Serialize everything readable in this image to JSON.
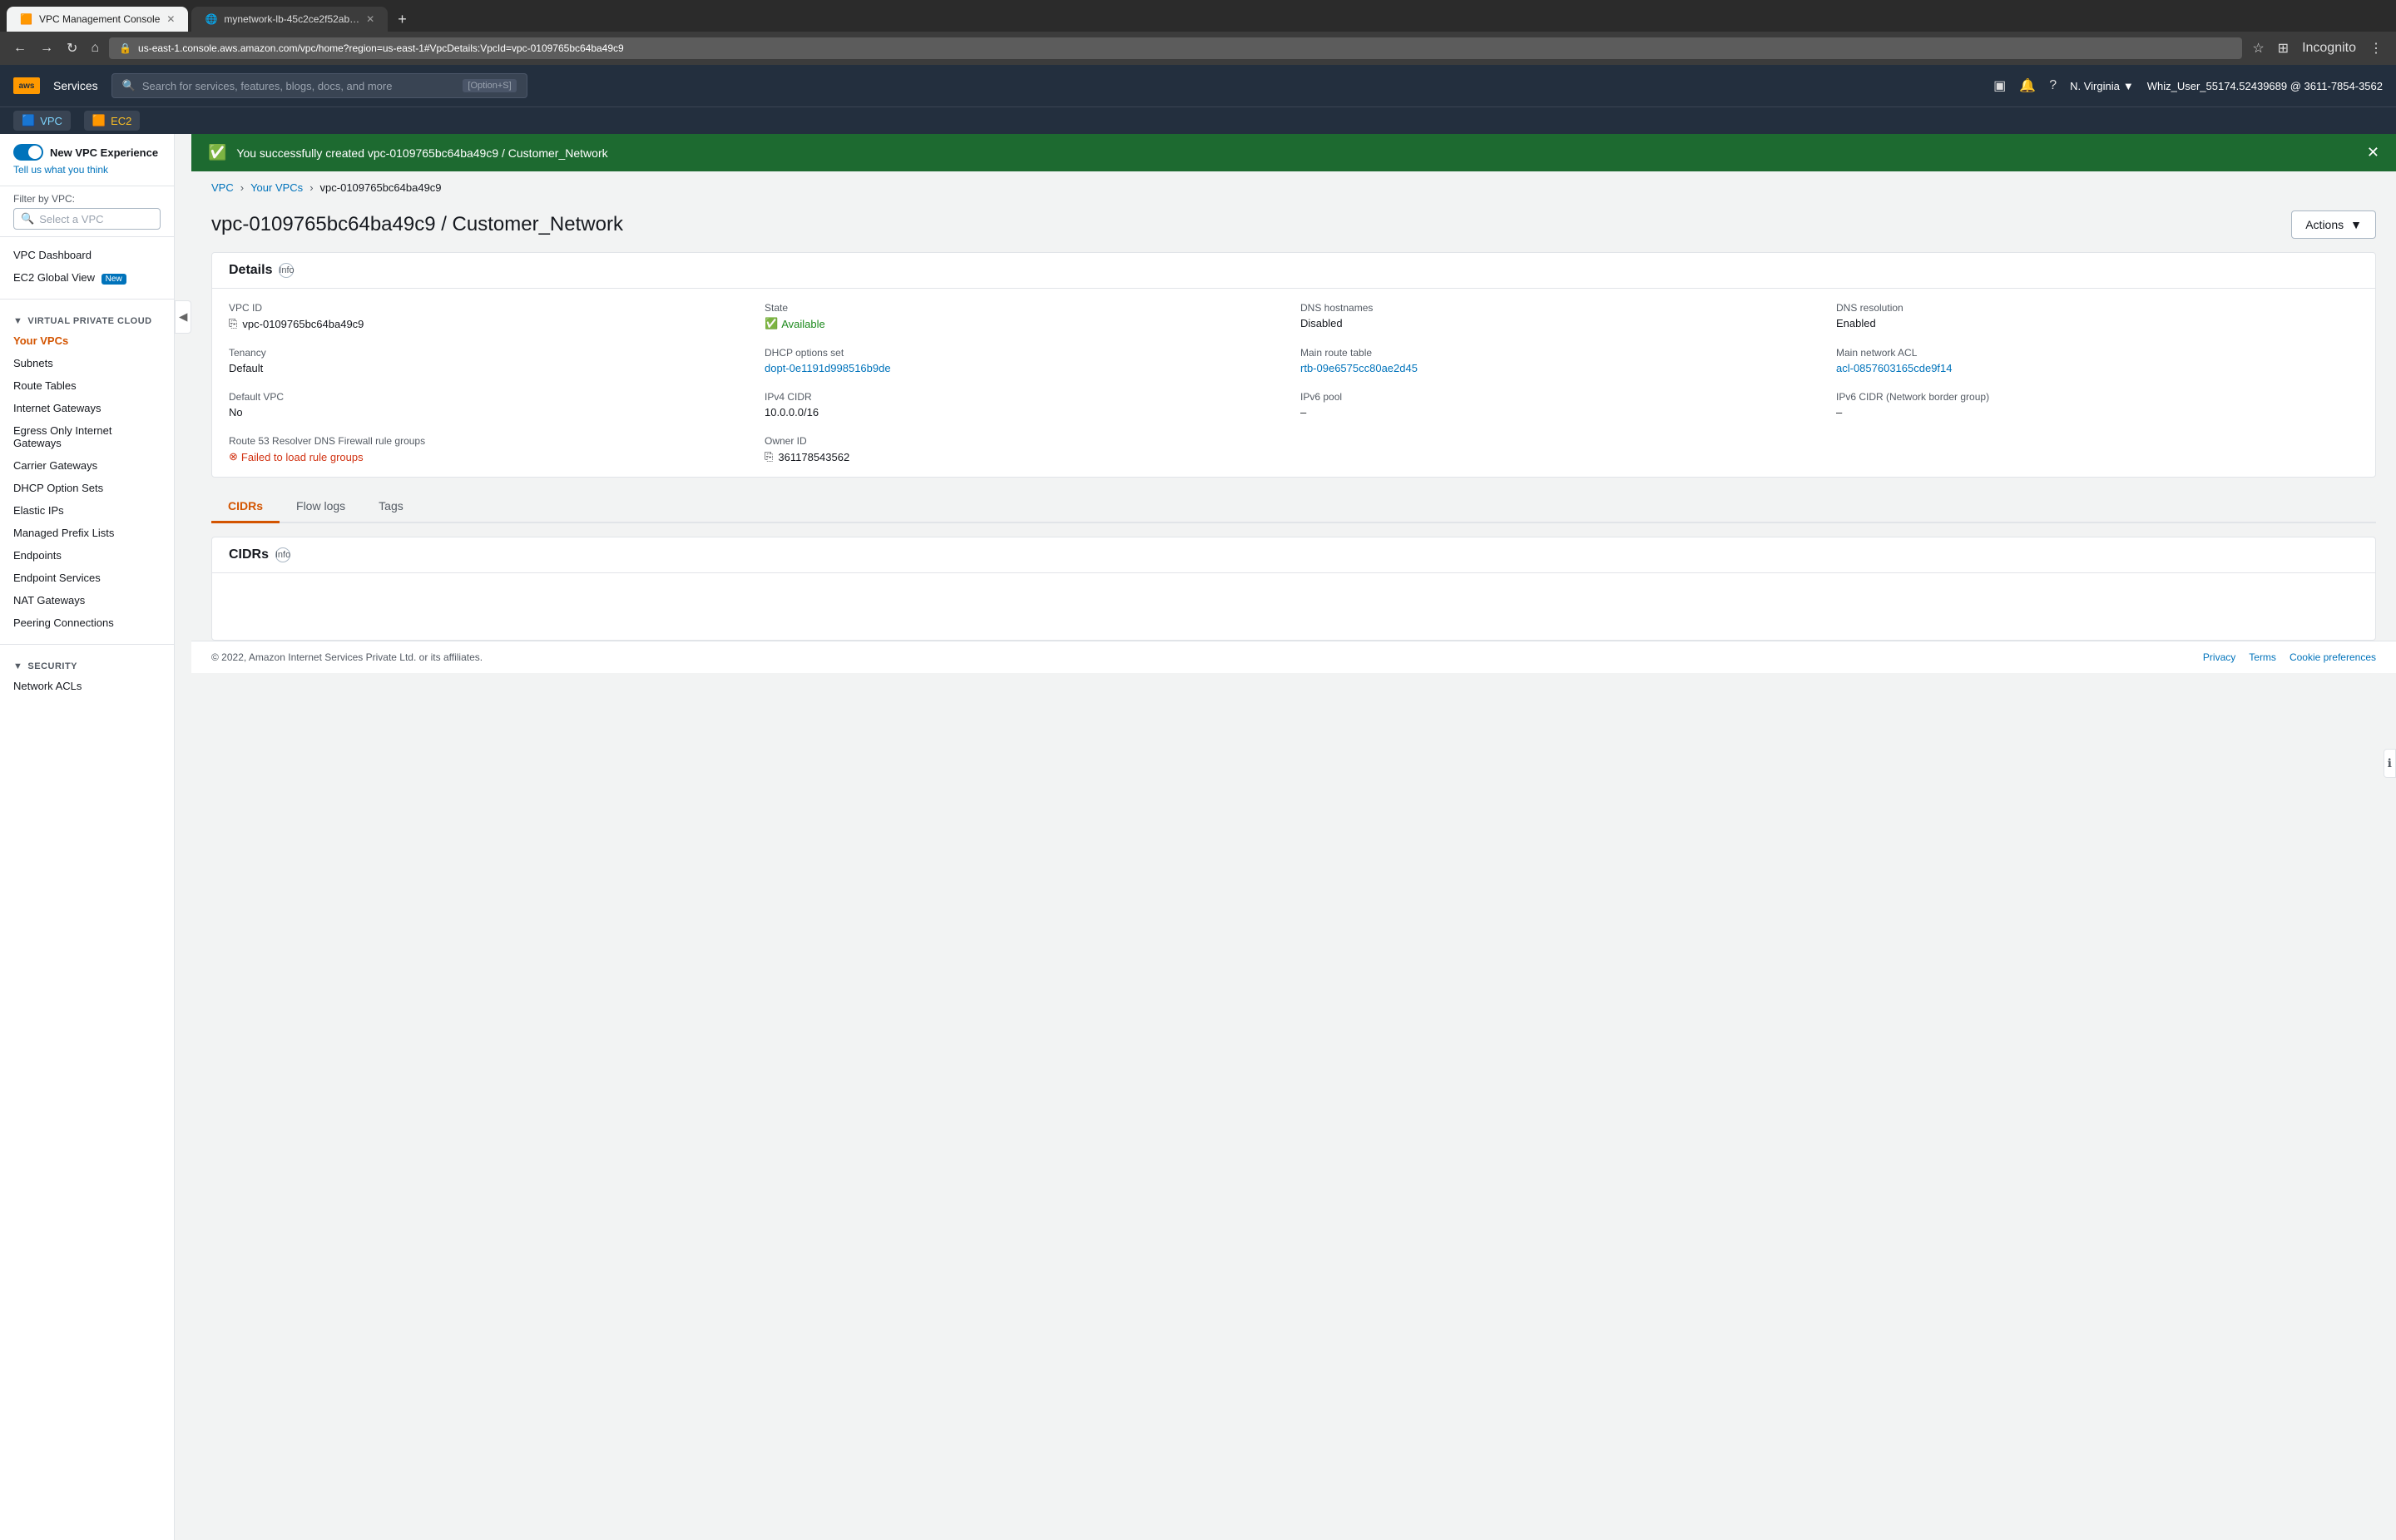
{
  "browser": {
    "tabs": [
      {
        "id": "vpc-tab",
        "favicon": "🟧",
        "label": "VPC Management Console",
        "active": true
      },
      {
        "id": "network-tab",
        "favicon": "🌐",
        "label": "mynetwork-lb-45c2ce2f52ab…",
        "active": false
      }
    ],
    "new_tab_label": "+",
    "url": "us-east-1.console.aws.amazon.com/vpc/home?region=us-east-1#VpcDetails:VpcId=vpc-0109765bc64ba49c9",
    "lock_icon": "🔒",
    "nav_back": "←",
    "nav_forward": "→",
    "nav_reload": "↻",
    "nav_home": "⌂",
    "star_icon": "☆",
    "grid_icon": "⊞",
    "incognito": "Incognito",
    "more_icon": "⋮"
  },
  "aws_header": {
    "logo_text": "aws",
    "services_label": "Services",
    "search_placeholder": "Search for services, features, blogs, docs, and more",
    "search_shortcut": "[Option+S]",
    "terminal_icon": "▣",
    "bell_icon": "🔔",
    "help_icon": "?",
    "region": "N. Virginia",
    "region_arrow": "▼",
    "user": "Whiz_User_55174.52439689 @ 3611-7854-3562"
  },
  "service_bar": {
    "vpc_icon": "🟦",
    "vpc_label": "VPC",
    "ec2_icon": "🟧",
    "ec2_label": "EC2"
  },
  "sidebar": {
    "new_vpc_experience_label": "New VPC Experience",
    "tell_us_link": "Tell us what you think",
    "filter_label": "Filter by VPC:",
    "filter_placeholder": "Select a VPC",
    "items": [
      {
        "id": "vpc-dashboard",
        "label": "VPC Dashboard",
        "active": false
      },
      {
        "id": "ec2-global-view",
        "label": "EC2 Global View",
        "active": false,
        "badge": "New"
      },
      {
        "id": "section-vpc",
        "type": "section",
        "label": "VIRTUAL PRIVATE CLOUD"
      },
      {
        "id": "your-vpcs",
        "label": "Your VPCs",
        "active": true
      },
      {
        "id": "subnets",
        "label": "Subnets",
        "active": false
      },
      {
        "id": "route-tables",
        "label": "Route Tables",
        "active": false
      },
      {
        "id": "internet-gateways",
        "label": "Internet Gateways",
        "active": false
      },
      {
        "id": "egress-only",
        "label": "Egress Only Internet Gateways",
        "active": false
      },
      {
        "id": "carrier-gateways",
        "label": "Carrier Gateways",
        "active": false
      },
      {
        "id": "dhcp-option-sets",
        "label": "DHCP Option Sets",
        "active": false
      },
      {
        "id": "elastic-ips",
        "label": "Elastic IPs",
        "active": false
      },
      {
        "id": "managed-prefix-lists",
        "label": "Managed Prefix Lists",
        "active": false
      },
      {
        "id": "endpoints",
        "label": "Endpoints",
        "active": false
      },
      {
        "id": "endpoint-services",
        "label": "Endpoint Services",
        "active": false
      },
      {
        "id": "nat-gateways",
        "label": "NAT Gateways",
        "active": false
      },
      {
        "id": "peering-connections",
        "label": "Peering Connections",
        "active": false
      },
      {
        "id": "section-security",
        "type": "section",
        "label": "SECURITY"
      },
      {
        "id": "network-acls",
        "label": "Network ACLs",
        "active": false
      }
    ],
    "collapse_icon": "◀"
  },
  "success_banner": {
    "icon": "✅",
    "message": "You successfully created vpc-0109765bc64ba49c9 / Customer_Network",
    "close_icon": "✕"
  },
  "breadcrumb": {
    "items": [
      {
        "label": "VPC",
        "link": true
      },
      {
        "label": "Your VPCs",
        "link": true
      },
      {
        "label": "vpc-0109765bc64ba49c9",
        "link": false
      }
    ],
    "separator": "›"
  },
  "page_header": {
    "title": "vpc-0109765bc64ba49c9 / Customer_Network",
    "actions_label": "Actions",
    "actions_arrow": "▼"
  },
  "details_card": {
    "title": "Details",
    "info_label": "Info",
    "fields": [
      {
        "row": 1,
        "items": [
          {
            "label": "VPC ID",
            "value": "vpc-0109765bc64ba49c9",
            "type": "copy",
            "copy_icon": "⎘"
          },
          {
            "label": "State",
            "value": "Available",
            "type": "status-available",
            "icon": "✅"
          },
          {
            "label": "DNS hostnames",
            "value": "Disabled",
            "type": "text"
          },
          {
            "label": "DNS resolution",
            "value": "Enabled",
            "type": "text"
          }
        ]
      },
      {
        "row": 2,
        "items": [
          {
            "label": "Tenancy",
            "value": "Default",
            "type": "text"
          },
          {
            "label": "DHCP options set",
            "value": "dopt-0e1191d998516b9de",
            "type": "link"
          },
          {
            "label": "Main route table",
            "value": "rtb-09e6575cc80ae2d45",
            "type": "link"
          },
          {
            "label": "Main network ACL",
            "value": "acl-0857603165cde9f14",
            "type": "link"
          }
        ]
      },
      {
        "row": 3,
        "items": [
          {
            "label": "Default VPC",
            "value": "No",
            "type": "text"
          },
          {
            "label": "IPv4 CIDR",
            "value": "10.0.0.0/16",
            "type": "text"
          },
          {
            "label": "IPv6 pool",
            "value": "–",
            "type": "text"
          },
          {
            "label": "IPv6 CIDR (Network border group)",
            "value": "–",
            "type": "text"
          }
        ]
      },
      {
        "row": 4,
        "items": [
          {
            "label": "Route 53 Resolver DNS Firewall rule groups",
            "value": "Failed to load rule groups",
            "type": "error",
            "error_icon": "⊗"
          },
          {
            "label": "Owner ID",
            "value": "361178543562",
            "type": "copy-owner",
            "copy_icon": "⎘"
          },
          {
            "label": "",
            "value": "",
            "type": "empty"
          },
          {
            "label": "",
            "value": "",
            "type": "empty"
          }
        ]
      }
    ]
  },
  "tabs": {
    "items": [
      {
        "id": "cidrs",
        "label": "CIDRs",
        "active": true
      },
      {
        "id": "flow-logs",
        "label": "Flow logs",
        "active": false
      },
      {
        "id": "tags",
        "label": "Tags",
        "active": false
      }
    ]
  },
  "cidrs_section": {
    "title": "CIDRs",
    "info_label": "Info"
  },
  "footer": {
    "copyright": "© 2022, Amazon Internet Services Private Ltd. or its affiliates.",
    "links": [
      {
        "label": "Privacy"
      },
      {
        "label": "Terms"
      },
      {
        "label": "Cookie preferences"
      }
    ]
  }
}
